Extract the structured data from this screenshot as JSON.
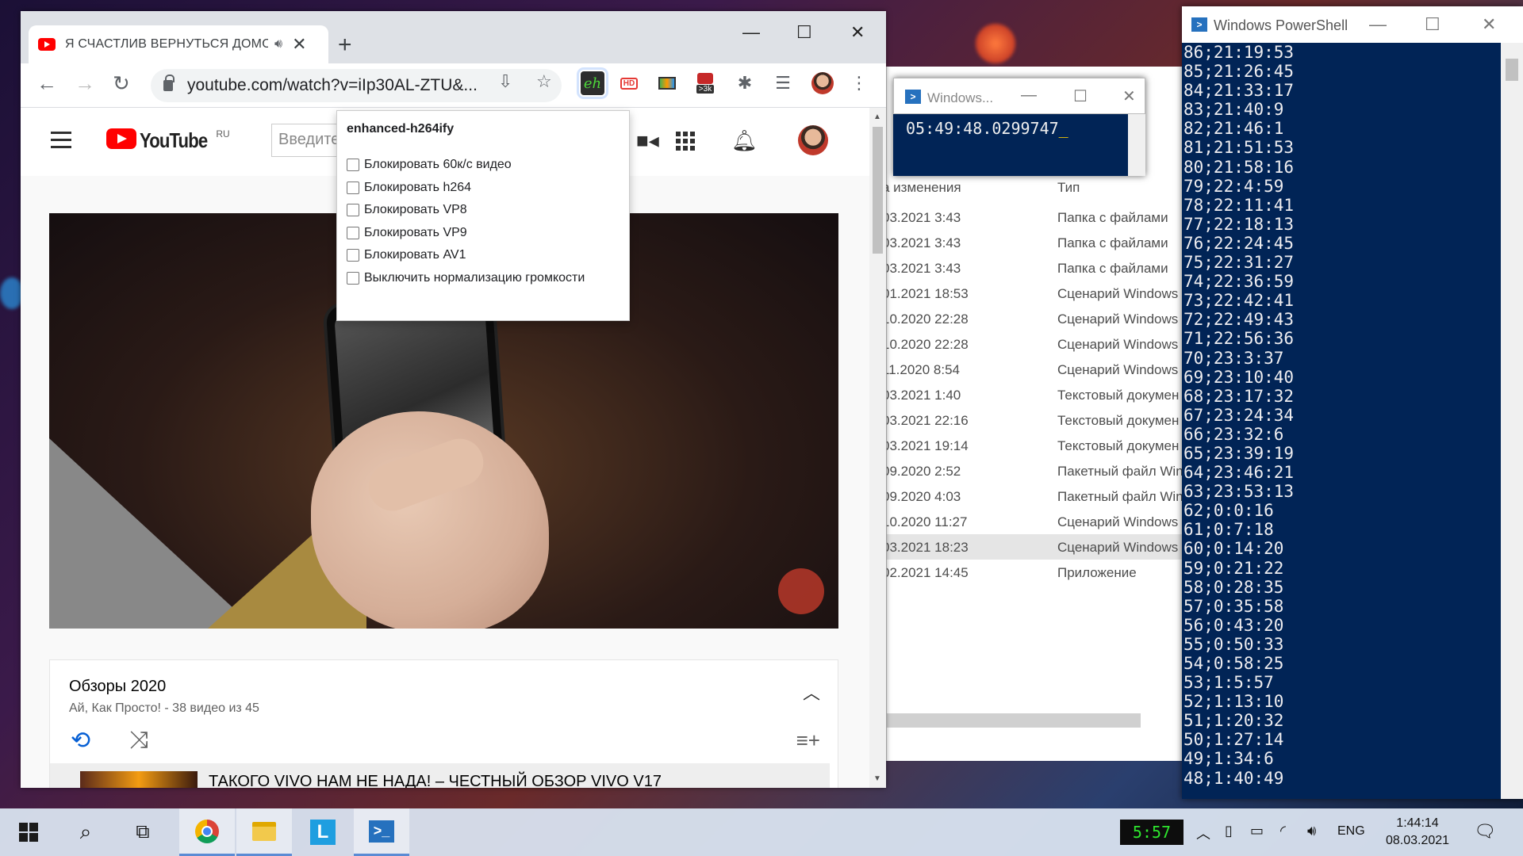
{
  "browser": {
    "tab_title": "Я СЧАСТЛИВ ВЕРНУТЬСЯ ДОМОЙ",
    "new_tab": "+",
    "url": "youtube.com/watch?v=iIp30AL-ZTU&...",
    "ext_badge": ">3k",
    "ext_eh_label": "eh",
    "ext_hd_label": "HD",
    "window": {
      "minimize": "—",
      "maximize": "☐",
      "close": "✕"
    }
  },
  "youtube": {
    "logo_text": "YouTube",
    "region": "RU",
    "search_placeholder": "Введите запрос",
    "playlist": {
      "title": "Обзоры 2020",
      "channel": "Ай, Как Просто!",
      "count": "- 38 видео из 45",
      "current_item": "ТАКОГО VIVO НАМ НЕ НАДА! – ЧЕСТНЫЙ ОБЗОР VIVO V17"
    }
  },
  "popup": {
    "title": "enhanced-h264ify",
    "options": [
      "Блокировать 60к/с видео",
      "Блокировать h264",
      "Блокировать VP8",
      "Блокировать VP9",
      "Блокировать AV1",
      "Выключить нормализацию громкости"
    ]
  },
  "explorer": {
    "col_date": "а изменения",
    "col_type": "Тип",
    "rows": [
      {
        "date": "03.2021 3:43",
        "type": "Папка с файлами"
      },
      {
        "date": "03.2021 3:43",
        "type": "Папка с файлами"
      },
      {
        "date": "03.2021 3:43",
        "type": "Папка с файлами"
      },
      {
        "date": "01.2021 18:53",
        "type": "Сценарий Windows"
      },
      {
        "date": "10.2020 22:28",
        "type": "Сценарий Windows"
      },
      {
        "date": "10.2020 22:28",
        "type": "Сценарий Windows"
      },
      {
        "date": "11.2020 8:54",
        "type": "Сценарий Windows"
      },
      {
        "date": "03.2021 1:40",
        "type": "Текстовый докумен"
      },
      {
        "date": "03.2021 22:16",
        "type": "Текстовый докумен"
      },
      {
        "date": "03.2021 19:14",
        "type": "Текстовый докумен"
      },
      {
        "date": "09.2020 2:52",
        "type": "Пакетный файл Win"
      },
      {
        "date": "09.2020 4:03",
        "type": "Пакетный файл Win"
      },
      {
        "date": "10.2020 11:27",
        "type": "Сценарий Windows"
      },
      {
        "date": "03.2021 18:23",
        "type": "Сценарий Windows"
      },
      {
        "date": "02.2021 14:45",
        "type": "Приложение"
      }
    ]
  },
  "ps_small": {
    "title": "Windows...",
    "text": "05:49:48.0299747"
  },
  "ps_big": {
    "title": "Windows PowerShell",
    "lines": [
      "86;21:19:53",
      "85;21:26:45",
      "84;21:33:17",
      "83;21:40:9",
      "82;21:46:1",
      "81;21:51:53",
      "80;21:58:16",
      "79;22:4:59",
      "78;22:11:41",
      "77;22:18:13",
      "76;22:24:45",
      "75;22:31:27",
      "74;22:36:59",
      "73;22:42:41",
      "72;22:49:43",
      "71;22:56:36",
      "70;23:3:37",
      "69;23:10:40",
      "68;23:17:32",
      "67;23:24:34",
      "66;23:32:6",
      "65;23:39:19",
      "64;23:46:21",
      "63;23:53:13",
      "62;0:0:16",
      "61;0:7:18",
      "60;0:14:20",
      "59;0:21:22",
      "58;0:28:35",
      "57;0:35:58",
      "56;0:43:20",
      "55;0:50:33",
      "54;0:58:25",
      "53;1:5:57",
      "52;1:13:10",
      "51;1:20:32",
      "50;1:27:14",
      "49;1:34:6",
      "48;1:40:49"
    ]
  },
  "taskbar": {
    "widget_time": "5:57",
    "lang": "ENG",
    "time": "1:44:14",
    "date": "08.03.2021",
    "l_app": "L"
  }
}
